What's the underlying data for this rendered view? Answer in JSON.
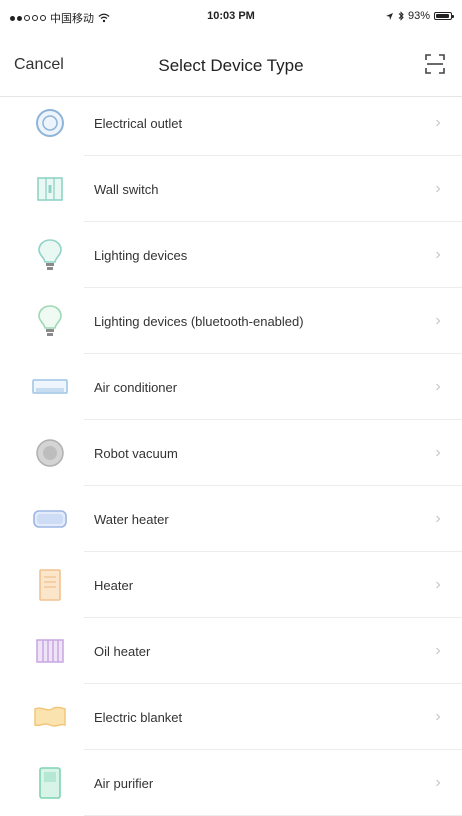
{
  "status_bar": {
    "carrier": "中国移动",
    "time": "10:03 PM",
    "battery": "93%",
    "battery_level": 0.93
  },
  "nav": {
    "cancel_label": "Cancel",
    "title": "Select Device Type",
    "scan_icon": "scan-icon"
  },
  "devices": [
    {
      "label": "Electrical outlet",
      "icon": "outlet-icon",
      "color": "#8fb4d9"
    },
    {
      "label": "Wall switch",
      "icon": "wall-switch-icon",
      "color": "#8fd3c6"
    },
    {
      "label": "Lighting devices",
      "icon": "bulb-icon",
      "color": "#8fd3c6"
    },
    {
      "label": "Lighting devices (bluetooth-enabled)",
      "icon": "bulb-bluetooth-icon",
      "color": "#9ed7b4"
    },
    {
      "label": "Air conditioner",
      "icon": "air-conditioner-icon",
      "color": "#9cc3e6"
    },
    {
      "label": "Robot vacuum",
      "icon": "robot-vacuum-icon",
      "color": "#b0b0b0"
    },
    {
      "label": "Water heater",
      "icon": "water-heater-icon",
      "color": "#9cb6e6"
    },
    {
      "label": "Heater",
      "icon": "heater-icon",
      "color": "#f0c28f"
    },
    {
      "label": "Oil heater",
      "icon": "oil-heater-icon",
      "color": "#c8a6e0"
    },
    {
      "label": "Electric blanket",
      "icon": "electric-blanket-icon",
      "color": "#f3c67a"
    },
    {
      "label": "Air purifier",
      "icon": "air-purifier-icon",
      "color": "#7fd3b0"
    }
  ]
}
